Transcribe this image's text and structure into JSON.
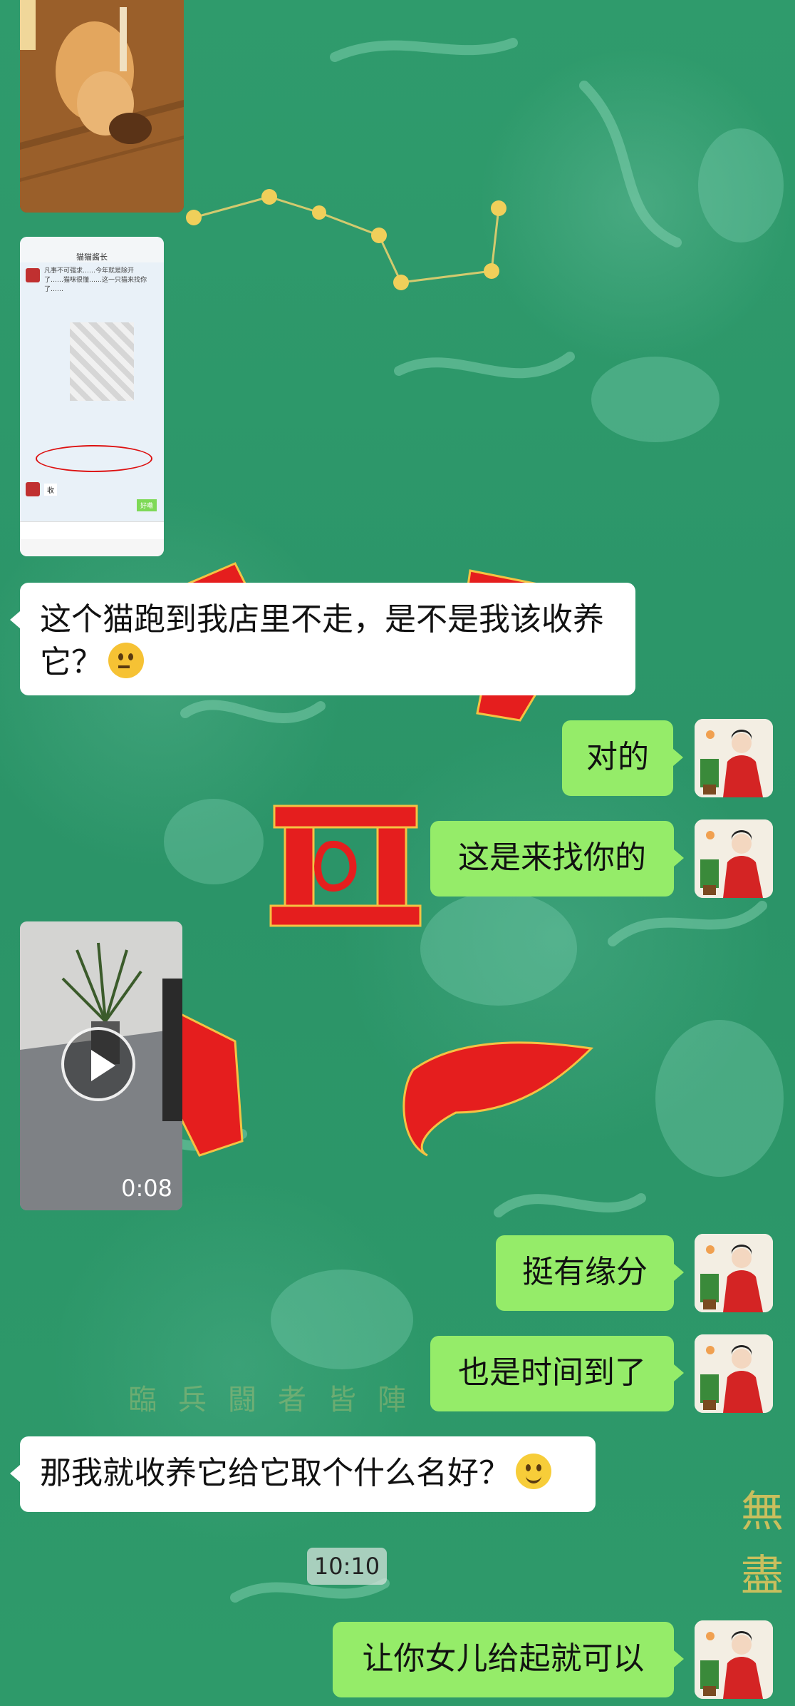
{
  "chat": {
    "messages": [
      {
        "side": "in",
        "type": "image",
        "desc": "orange cat"
      },
      {
        "side": "in",
        "type": "image",
        "desc": "chat screenshot"
      },
      {
        "side": "in",
        "type": "text",
        "text": "这个猫跑到我店里不走，是不是我该收养它？",
        "emoji": "thinking-face"
      },
      {
        "side": "out",
        "type": "text",
        "text": "对的"
      },
      {
        "side": "out",
        "type": "text",
        "text": "这是来找你的"
      },
      {
        "side": "in",
        "type": "video",
        "duration": "0:08"
      },
      {
        "side": "out",
        "type": "text",
        "text": "挺有缘分"
      },
      {
        "side": "out",
        "type": "text",
        "text": "也是时间到了"
      },
      {
        "side": "in",
        "type": "text",
        "text": "那我就收养它给它取个什么名好？",
        "emoji": "smiling-face"
      },
      {
        "side": "system",
        "type": "time",
        "text": "10:10"
      },
      {
        "side": "out",
        "type": "text",
        "text": "让你女儿给起就可以"
      }
    ]
  },
  "screenshot_thumb": {
    "title": "猫猫酱长",
    "body": "凡事不可强求……今年就是除开了……猫咪很懂……这一只猫来找你了……",
    "reply": "收",
    "button": "好嘞"
  },
  "background": {
    "watermark": "臨兵闘者皆陣",
    "vertical_text": "無盡"
  },
  "colors": {
    "background": "#2f9a6c",
    "incoming_bubble": "#ffffff",
    "outgoing_bubble": "#95ec69",
    "accent_red": "#e51e1e"
  }
}
